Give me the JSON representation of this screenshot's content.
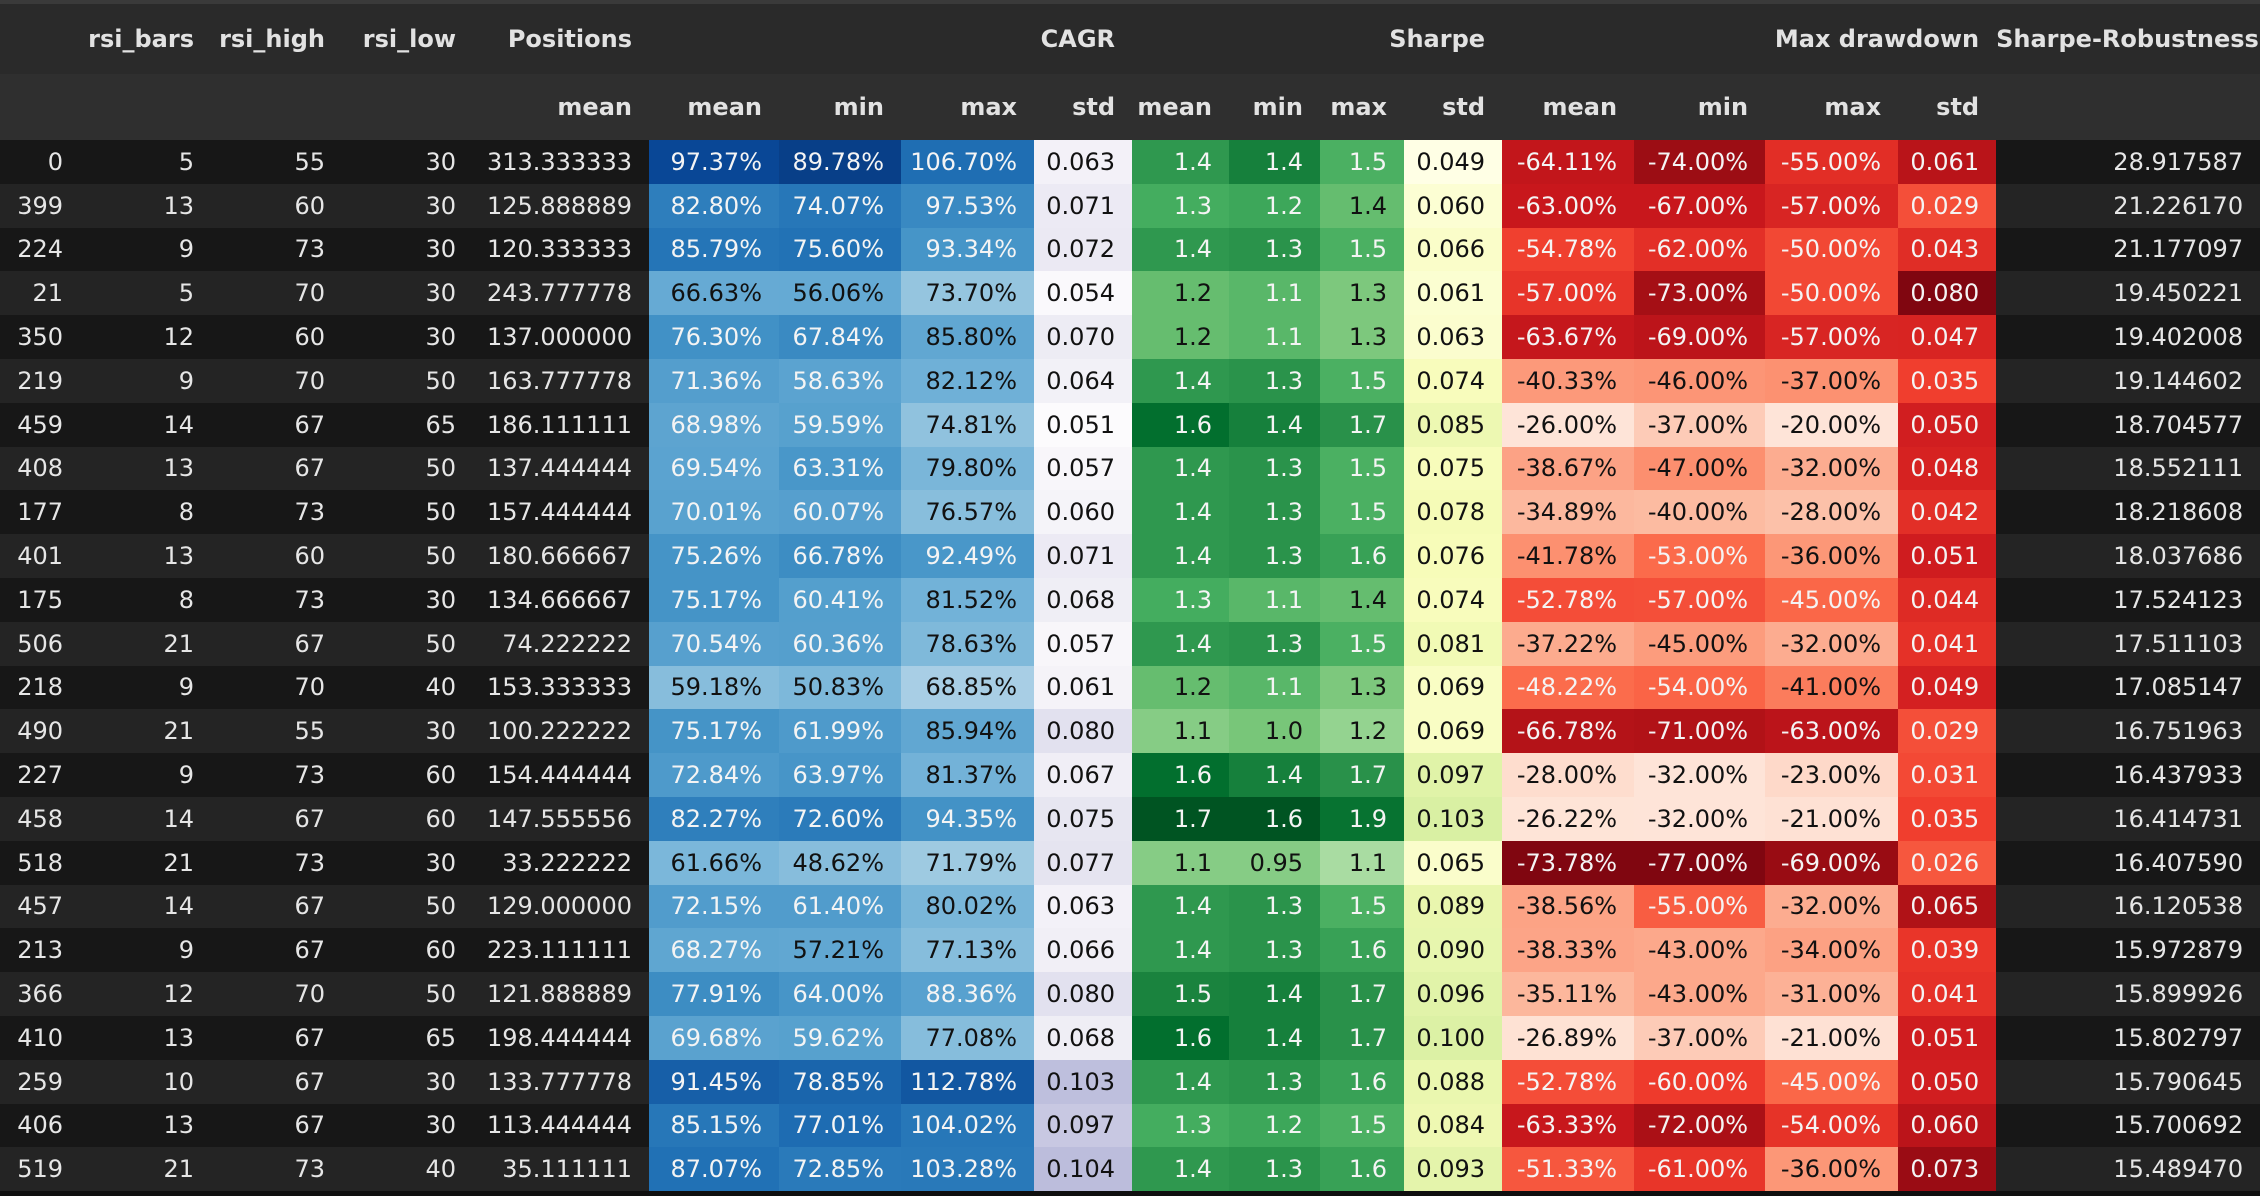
{
  "headers_top": [
    "",
    "rsi_bars",
    "rsi_high",
    "rsi_low",
    "Positions",
    "CAGR",
    "Sharpe",
    "Max drawdown",
    "Sharpe-Robustness"
  ],
  "headers_sub": [
    "mean",
    "mean",
    "min",
    "max",
    "std",
    "mean",
    "min",
    "max",
    "std",
    "mean",
    "min",
    "max",
    "std"
  ],
  "rows": [
    {
      "idx": "0",
      "bars": "5",
      "high": "55",
      "low": "30",
      "pos": "313.333333",
      "cagr_mean": "97.37%",
      "cagr_min": "89.78%",
      "cagr_max": "106.70%",
      "cagr_std": "0.063",
      "sh_mean": "1.4",
      "sh_min": "1.4",
      "sh_max": "1.5",
      "sh_std": "0.049",
      "dd_mean": "-64.11%",
      "dd_min": "-74.00%",
      "dd_max": "-55.00%",
      "dd_std": "0.061",
      "robust": "28.917587"
    },
    {
      "idx": "399",
      "bars": "13",
      "high": "60",
      "low": "30",
      "pos": "125.888889",
      "cagr_mean": "82.80%",
      "cagr_min": "74.07%",
      "cagr_max": "97.53%",
      "cagr_std": "0.071",
      "sh_mean": "1.3",
      "sh_min": "1.2",
      "sh_max": "1.4",
      "sh_std": "0.060",
      "dd_mean": "-63.00%",
      "dd_min": "-67.00%",
      "dd_max": "-57.00%",
      "dd_std": "0.029",
      "robust": "21.226170"
    },
    {
      "idx": "224",
      "bars": "9",
      "high": "73",
      "low": "30",
      "pos": "120.333333",
      "cagr_mean": "85.79%",
      "cagr_min": "75.60%",
      "cagr_max": "93.34%",
      "cagr_std": "0.072",
      "sh_mean": "1.4",
      "sh_min": "1.3",
      "sh_max": "1.5",
      "sh_std": "0.066",
      "dd_mean": "-54.78%",
      "dd_min": "-62.00%",
      "dd_max": "-50.00%",
      "dd_std": "0.043",
      "robust": "21.177097"
    },
    {
      "idx": "21",
      "bars": "5",
      "high": "70",
      "low": "30",
      "pos": "243.777778",
      "cagr_mean": "66.63%",
      "cagr_min": "56.06%",
      "cagr_max": "73.70%",
      "cagr_std": "0.054",
      "sh_mean": "1.2",
      "sh_min": "1.1",
      "sh_max": "1.3",
      "sh_std": "0.061",
      "dd_mean": "-57.00%",
      "dd_min": "-73.00%",
      "dd_max": "-50.00%",
      "dd_std": "0.080",
      "robust": "19.450221"
    },
    {
      "idx": "350",
      "bars": "12",
      "high": "60",
      "low": "30",
      "pos": "137.000000",
      "cagr_mean": "76.30%",
      "cagr_min": "67.84%",
      "cagr_max": "85.80%",
      "cagr_std": "0.070",
      "sh_mean": "1.2",
      "sh_min": "1.1",
      "sh_max": "1.3",
      "sh_std": "0.063",
      "dd_mean": "-63.67%",
      "dd_min": "-69.00%",
      "dd_max": "-57.00%",
      "dd_std": "0.047",
      "robust": "19.402008"
    },
    {
      "idx": "219",
      "bars": "9",
      "high": "70",
      "low": "50",
      "pos": "163.777778",
      "cagr_mean": "71.36%",
      "cagr_min": "58.63%",
      "cagr_max": "82.12%",
      "cagr_std": "0.064",
      "sh_mean": "1.4",
      "sh_min": "1.3",
      "sh_max": "1.5",
      "sh_std": "0.074",
      "dd_mean": "-40.33%",
      "dd_min": "-46.00%",
      "dd_max": "-37.00%",
      "dd_std": "0.035",
      "robust": "19.144602"
    },
    {
      "idx": "459",
      "bars": "14",
      "high": "67",
      "low": "65",
      "pos": "186.111111",
      "cagr_mean": "68.98%",
      "cagr_min": "59.59%",
      "cagr_max": "74.81%",
      "cagr_std": "0.051",
      "sh_mean": "1.6",
      "sh_min": "1.4",
      "sh_max": "1.7",
      "sh_std": "0.085",
      "dd_mean": "-26.00%",
      "dd_min": "-37.00%",
      "dd_max": "-20.00%",
      "dd_std": "0.050",
      "robust": "18.704577"
    },
    {
      "idx": "408",
      "bars": "13",
      "high": "67",
      "low": "50",
      "pos": "137.444444",
      "cagr_mean": "69.54%",
      "cagr_min": "63.31%",
      "cagr_max": "79.80%",
      "cagr_std": "0.057",
      "sh_mean": "1.4",
      "sh_min": "1.3",
      "sh_max": "1.5",
      "sh_std": "0.075",
      "dd_mean": "-38.67%",
      "dd_min": "-47.00%",
      "dd_max": "-32.00%",
      "dd_std": "0.048",
      "robust": "18.552111"
    },
    {
      "idx": "177",
      "bars": "8",
      "high": "73",
      "low": "50",
      "pos": "157.444444",
      "cagr_mean": "70.01%",
      "cagr_min": "60.07%",
      "cagr_max": "76.57%",
      "cagr_std": "0.060",
      "sh_mean": "1.4",
      "sh_min": "1.3",
      "sh_max": "1.5",
      "sh_std": "0.078",
      "dd_mean": "-34.89%",
      "dd_min": "-40.00%",
      "dd_max": "-28.00%",
      "dd_std": "0.042",
      "robust": "18.218608"
    },
    {
      "idx": "401",
      "bars": "13",
      "high": "60",
      "low": "50",
      "pos": "180.666667",
      "cagr_mean": "75.26%",
      "cagr_min": "66.78%",
      "cagr_max": "92.49%",
      "cagr_std": "0.071",
      "sh_mean": "1.4",
      "sh_min": "1.3",
      "sh_max": "1.6",
      "sh_std": "0.076",
      "dd_mean": "-41.78%",
      "dd_min": "-53.00%",
      "dd_max": "-36.00%",
      "dd_std": "0.051",
      "robust": "18.037686"
    },
    {
      "idx": "175",
      "bars": "8",
      "high": "73",
      "low": "30",
      "pos": "134.666667",
      "cagr_mean": "75.17%",
      "cagr_min": "60.41%",
      "cagr_max": "81.52%",
      "cagr_std": "0.068",
      "sh_mean": "1.3",
      "sh_min": "1.1",
      "sh_max": "1.4",
      "sh_std": "0.074",
      "dd_mean": "-52.78%",
      "dd_min": "-57.00%",
      "dd_max": "-45.00%",
      "dd_std": "0.044",
      "robust": "17.524123"
    },
    {
      "idx": "506",
      "bars": "21",
      "high": "67",
      "low": "50",
      "pos": "74.222222",
      "cagr_mean": "70.54%",
      "cagr_min": "60.36%",
      "cagr_max": "78.63%",
      "cagr_std": "0.057",
      "sh_mean": "1.4",
      "sh_min": "1.3",
      "sh_max": "1.5",
      "sh_std": "0.081",
      "dd_mean": "-37.22%",
      "dd_min": "-45.00%",
      "dd_max": "-32.00%",
      "dd_std": "0.041",
      "robust": "17.511103"
    },
    {
      "idx": "218",
      "bars": "9",
      "high": "70",
      "low": "40",
      "pos": "153.333333",
      "cagr_mean": "59.18%",
      "cagr_min": "50.83%",
      "cagr_max": "68.85%",
      "cagr_std": "0.061",
      "sh_mean": "1.2",
      "sh_min": "1.1",
      "sh_max": "1.3",
      "sh_std": "0.069",
      "dd_mean": "-48.22%",
      "dd_min": "-54.00%",
      "dd_max": "-41.00%",
      "dd_std": "0.049",
      "robust": "17.085147"
    },
    {
      "idx": "490",
      "bars": "21",
      "high": "55",
      "low": "30",
      "pos": "100.222222",
      "cagr_mean": "75.17%",
      "cagr_min": "61.99%",
      "cagr_max": "85.94%",
      "cagr_std": "0.080",
      "sh_mean": "1.1",
      "sh_min": "1.0",
      "sh_max": "1.2",
      "sh_std": "0.069",
      "dd_mean": "-66.78%",
      "dd_min": "-71.00%",
      "dd_max": "-63.00%",
      "dd_std": "0.029",
      "robust": "16.751963"
    },
    {
      "idx": "227",
      "bars": "9",
      "high": "73",
      "low": "60",
      "pos": "154.444444",
      "cagr_mean": "72.84%",
      "cagr_min": "63.97%",
      "cagr_max": "81.37%",
      "cagr_std": "0.067",
      "sh_mean": "1.6",
      "sh_min": "1.4",
      "sh_max": "1.7",
      "sh_std": "0.097",
      "dd_mean": "-28.00%",
      "dd_min": "-32.00%",
      "dd_max": "-23.00%",
      "dd_std": "0.031",
      "robust": "16.437933"
    },
    {
      "idx": "458",
      "bars": "14",
      "high": "67",
      "low": "60",
      "pos": "147.555556",
      "cagr_mean": "82.27%",
      "cagr_min": "72.60%",
      "cagr_max": "94.35%",
      "cagr_std": "0.075",
      "sh_mean": "1.7",
      "sh_min": "1.6",
      "sh_max": "1.9",
      "sh_std": "0.103",
      "dd_mean": "-26.22%",
      "dd_min": "-32.00%",
      "dd_max": "-21.00%",
      "dd_std": "0.035",
      "robust": "16.414731"
    },
    {
      "idx": "518",
      "bars": "21",
      "high": "73",
      "low": "30",
      "pos": "33.222222",
      "cagr_mean": "61.66%",
      "cagr_min": "48.62%",
      "cagr_max": "71.79%",
      "cagr_std": "0.077",
      "sh_mean": "1.1",
      "sh_min": "0.95",
      "sh_max": "1.1",
      "sh_std": "0.065",
      "dd_mean": "-73.78%",
      "dd_min": "-77.00%",
      "dd_max": "-69.00%",
      "dd_std": "0.026",
      "robust": "16.407590"
    },
    {
      "idx": "457",
      "bars": "14",
      "high": "67",
      "low": "50",
      "pos": "129.000000",
      "cagr_mean": "72.15%",
      "cagr_min": "61.40%",
      "cagr_max": "80.02%",
      "cagr_std": "0.063",
      "sh_mean": "1.4",
      "sh_min": "1.3",
      "sh_max": "1.5",
      "sh_std": "0.089",
      "dd_mean": "-38.56%",
      "dd_min": "-55.00%",
      "dd_max": "-32.00%",
      "dd_std": "0.065",
      "robust": "16.120538"
    },
    {
      "idx": "213",
      "bars": "9",
      "high": "67",
      "low": "60",
      "pos": "223.111111",
      "cagr_mean": "68.27%",
      "cagr_min": "57.21%",
      "cagr_max": "77.13%",
      "cagr_std": "0.066",
      "sh_mean": "1.4",
      "sh_min": "1.3",
      "sh_max": "1.6",
      "sh_std": "0.090",
      "dd_mean": "-38.33%",
      "dd_min": "-43.00%",
      "dd_max": "-34.00%",
      "dd_std": "0.039",
      "robust": "15.972879"
    },
    {
      "idx": "366",
      "bars": "12",
      "high": "70",
      "low": "50",
      "pos": "121.888889",
      "cagr_mean": "77.91%",
      "cagr_min": "64.00%",
      "cagr_max": "88.36%",
      "cagr_std": "0.080",
      "sh_mean": "1.5",
      "sh_min": "1.4",
      "sh_max": "1.7",
      "sh_std": "0.096",
      "dd_mean": "-35.11%",
      "dd_min": "-43.00%",
      "dd_max": "-31.00%",
      "dd_std": "0.041",
      "robust": "15.899926"
    },
    {
      "idx": "410",
      "bars": "13",
      "high": "67",
      "low": "65",
      "pos": "198.444444",
      "cagr_mean": "69.68%",
      "cagr_min": "59.62%",
      "cagr_max": "77.08%",
      "cagr_std": "0.068",
      "sh_mean": "1.6",
      "sh_min": "1.4",
      "sh_max": "1.7",
      "sh_std": "0.100",
      "dd_mean": "-26.89%",
      "dd_min": "-37.00%",
      "dd_max": "-21.00%",
      "dd_std": "0.051",
      "robust": "15.802797"
    },
    {
      "idx": "259",
      "bars": "10",
      "high": "67",
      "low": "30",
      "pos": "133.777778",
      "cagr_mean": "91.45%",
      "cagr_min": "78.85%",
      "cagr_max": "112.78%",
      "cagr_std": "0.103",
      "sh_mean": "1.4",
      "sh_min": "1.3",
      "sh_max": "1.6",
      "sh_std": "0.088",
      "dd_mean": "-52.78%",
      "dd_min": "-60.00%",
      "dd_max": "-45.00%",
      "dd_std": "0.050",
      "robust": "15.790645"
    },
    {
      "idx": "406",
      "bars": "13",
      "high": "67",
      "low": "30",
      "pos": "113.444444",
      "cagr_mean": "85.15%",
      "cagr_min": "77.01%",
      "cagr_max": "104.02%",
      "cagr_std": "0.097",
      "sh_mean": "1.3",
      "sh_min": "1.2",
      "sh_max": "1.5",
      "sh_std": "0.084",
      "dd_mean": "-63.33%",
      "dd_min": "-72.00%",
      "dd_max": "-54.00%",
      "dd_std": "0.060",
      "robust": "15.700692"
    },
    {
      "idx": "519",
      "bars": "21",
      "high": "73",
      "low": "40",
      "pos": "35.111111",
      "cagr_mean": "87.07%",
      "cagr_min": "72.85%",
      "cagr_max": "103.28%",
      "cagr_std": "0.104",
      "sh_mean": "1.4",
      "sh_min": "1.3",
      "sh_max": "1.6",
      "sh_std": "0.093",
      "dd_mean": "-51.33%",
      "dd_min": "-61.00%",
      "dd_max": "-36.00%",
      "dd_std": "0.073",
      "robust": "15.489470"
    }
  ]
}
